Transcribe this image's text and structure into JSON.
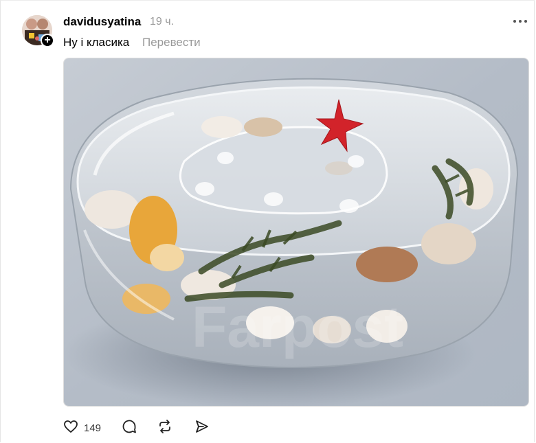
{
  "post": {
    "author": {
      "username": "davidusyatina",
      "avatar_icon": "avatar",
      "follow_badge": "+"
    },
    "timestamp": "19 ч.",
    "caption": "Ну і класика",
    "translate_label": "Перевести",
    "more_icon": "more-horizontal-icon",
    "media": {
      "kind": "photo",
      "subject": "clear resin soap dish with seashells, red starfish and seaweed",
      "watermark": "Farpost"
    },
    "actions": {
      "like_icon": "heart-icon",
      "like_count": "149",
      "comment_icon": "comment-icon",
      "repost_icon": "repost-icon",
      "share_icon": "send-icon"
    }
  },
  "colors": {
    "text": "#000000",
    "muted": "#999999",
    "border": "#e5e5e5",
    "starfish": "#d2232a"
  }
}
